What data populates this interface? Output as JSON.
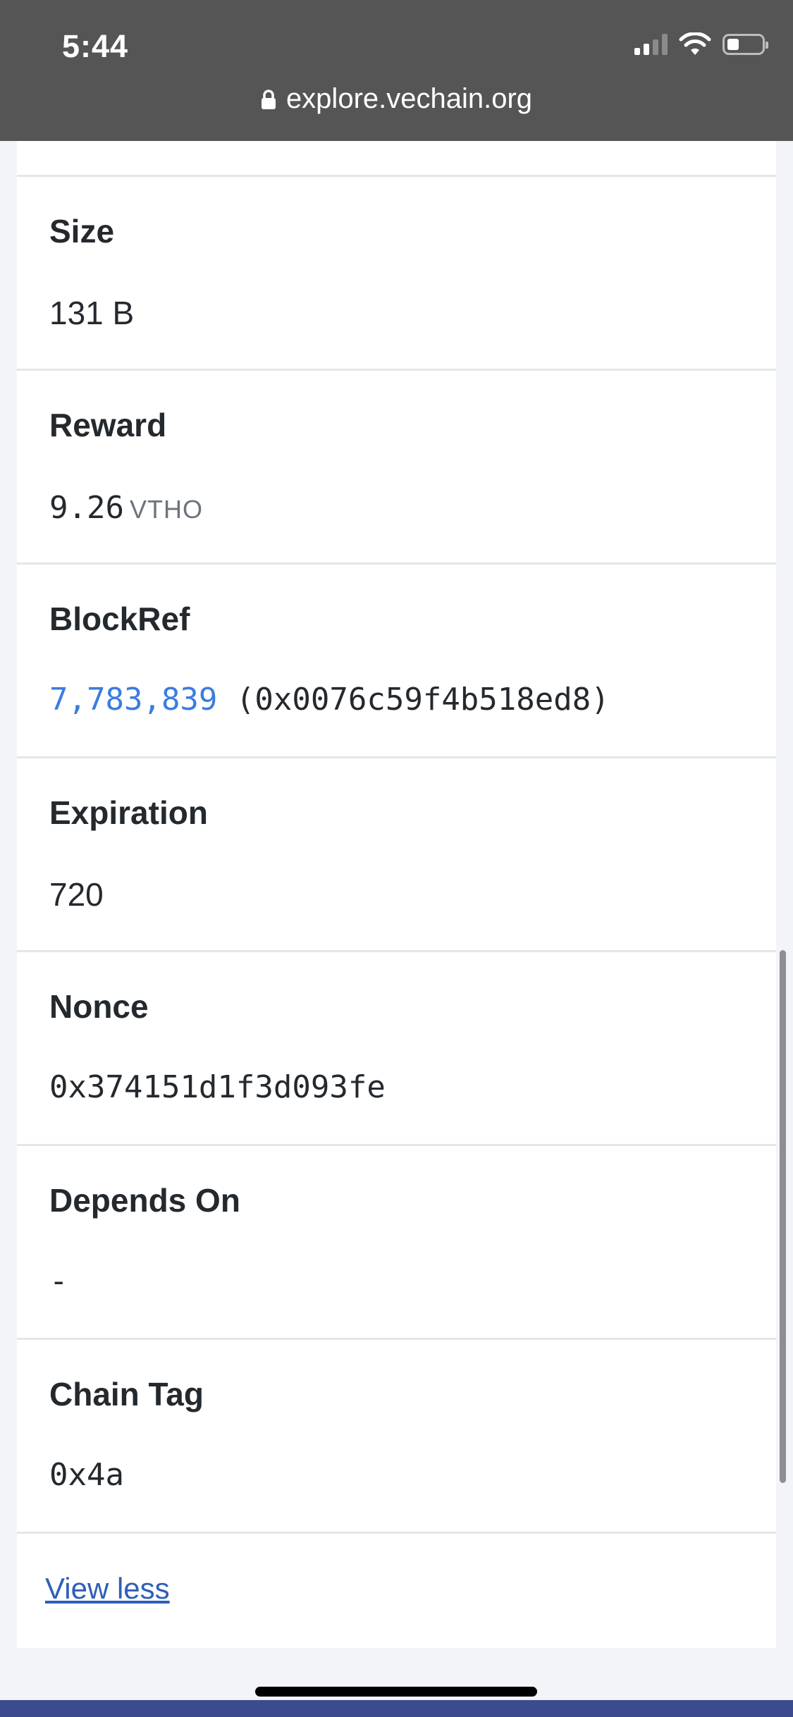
{
  "status_bar": {
    "time": "5:44",
    "icons": [
      "signal-icon",
      "wifi-icon",
      "battery-icon"
    ]
  },
  "browser": {
    "url": "explore.vechain.org",
    "lock_icon": "lock-icon"
  },
  "details": [
    {
      "label": "Size",
      "value": "131 B"
    },
    {
      "label": "Reward",
      "value": "9.26",
      "unit": "VTHO"
    },
    {
      "label": "BlockRef",
      "link": "7,783,839",
      "value": "(0x0076c59f4b518ed8)"
    },
    {
      "label": "Expiration",
      "value": "720"
    },
    {
      "label": "Nonce",
      "value": "0x374151d1f3d093fe"
    },
    {
      "label": "Depends On",
      "value": "-"
    },
    {
      "label": "Chain Tag",
      "value": "0x4a"
    }
  ],
  "view_less_label": "View less",
  "colors": {
    "link": "#3b7de0",
    "view_less": "#2f5eb7",
    "status_bar_bg": "#555556",
    "bottom_band": "#3b4b8e"
  }
}
